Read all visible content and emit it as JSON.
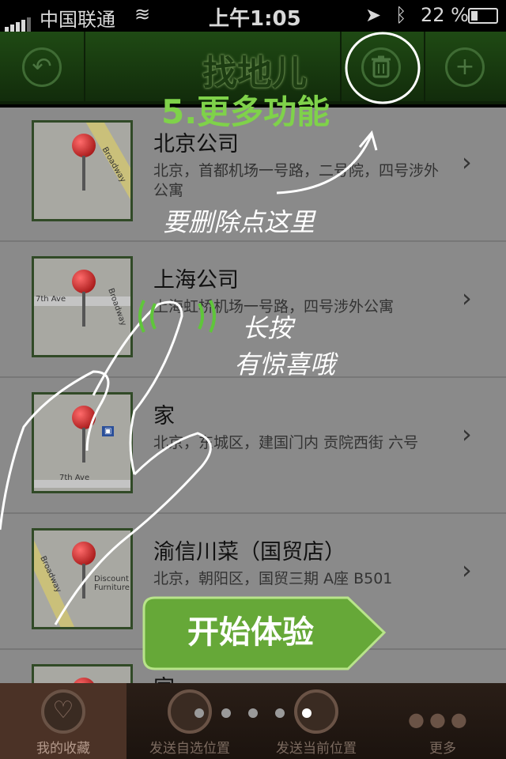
{
  "statusbar": {
    "carrier": "中国联通",
    "time": "上午1:05",
    "battery": "22 %"
  },
  "navbar": {
    "logo": "找地儿",
    "back_icon": "undo-icon",
    "delete_icon": "trash-icon",
    "add_icon": "plus-icon"
  },
  "list": {
    "items": [
      {
        "title": "北京公司",
        "address": "北京，首都机场一号路，二号院，四号涉外公寓"
      },
      {
        "title": "上海公司",
        "address": "上海虹桥机场一号路，四号涉外公寓"
      },
      {
        "title": "家",
        "address": "北京，东城区，建国门内 贡院西街 六号"
      },
      {
        "title": "渝信川菜（国贸店）",
        "address": "北京，朝阳区，国贸三期 A座 B501"
      },
      {
        "title": "家",
        "address": ""
      }
    ],
    "map_labels": {
      "broadway": "Broadway",
      "seventh_ave": "7th Ave",
      "discount": "Discount Furniture"
    }
  },
  "guide": {
    "title": "5.更多功能",
    "delete_hint": "要删除点这里",
    "longpress_line1": "长按",
    "longpress_line2": "有惊喜哦",
    "start_button": "开始体验",
    "pages": 5,
    "active_page": 5
  },
  "tabbar": {
    "tabs": [
      {
        "label": "我的收藏",
        "icon": "heart-icon",
        "active": true
      },
      {
        "label": "发送自选位置",
        "icon": "globe-icon",
        "active": false
      },
      {
        "label": "发送当前位置",
        "icon": "location-pin-icon",
        "active": false
      },
      {
        "label": "更多",
        "icon": "more-dots-icon",
        "active": false
      }
    ]
  },
  "colors": {
    "accent_green": "#7fd24a",
    "navbar_green": "#1f4a14",
    "tabbar_brown": "#2a1e17"
  }
}
